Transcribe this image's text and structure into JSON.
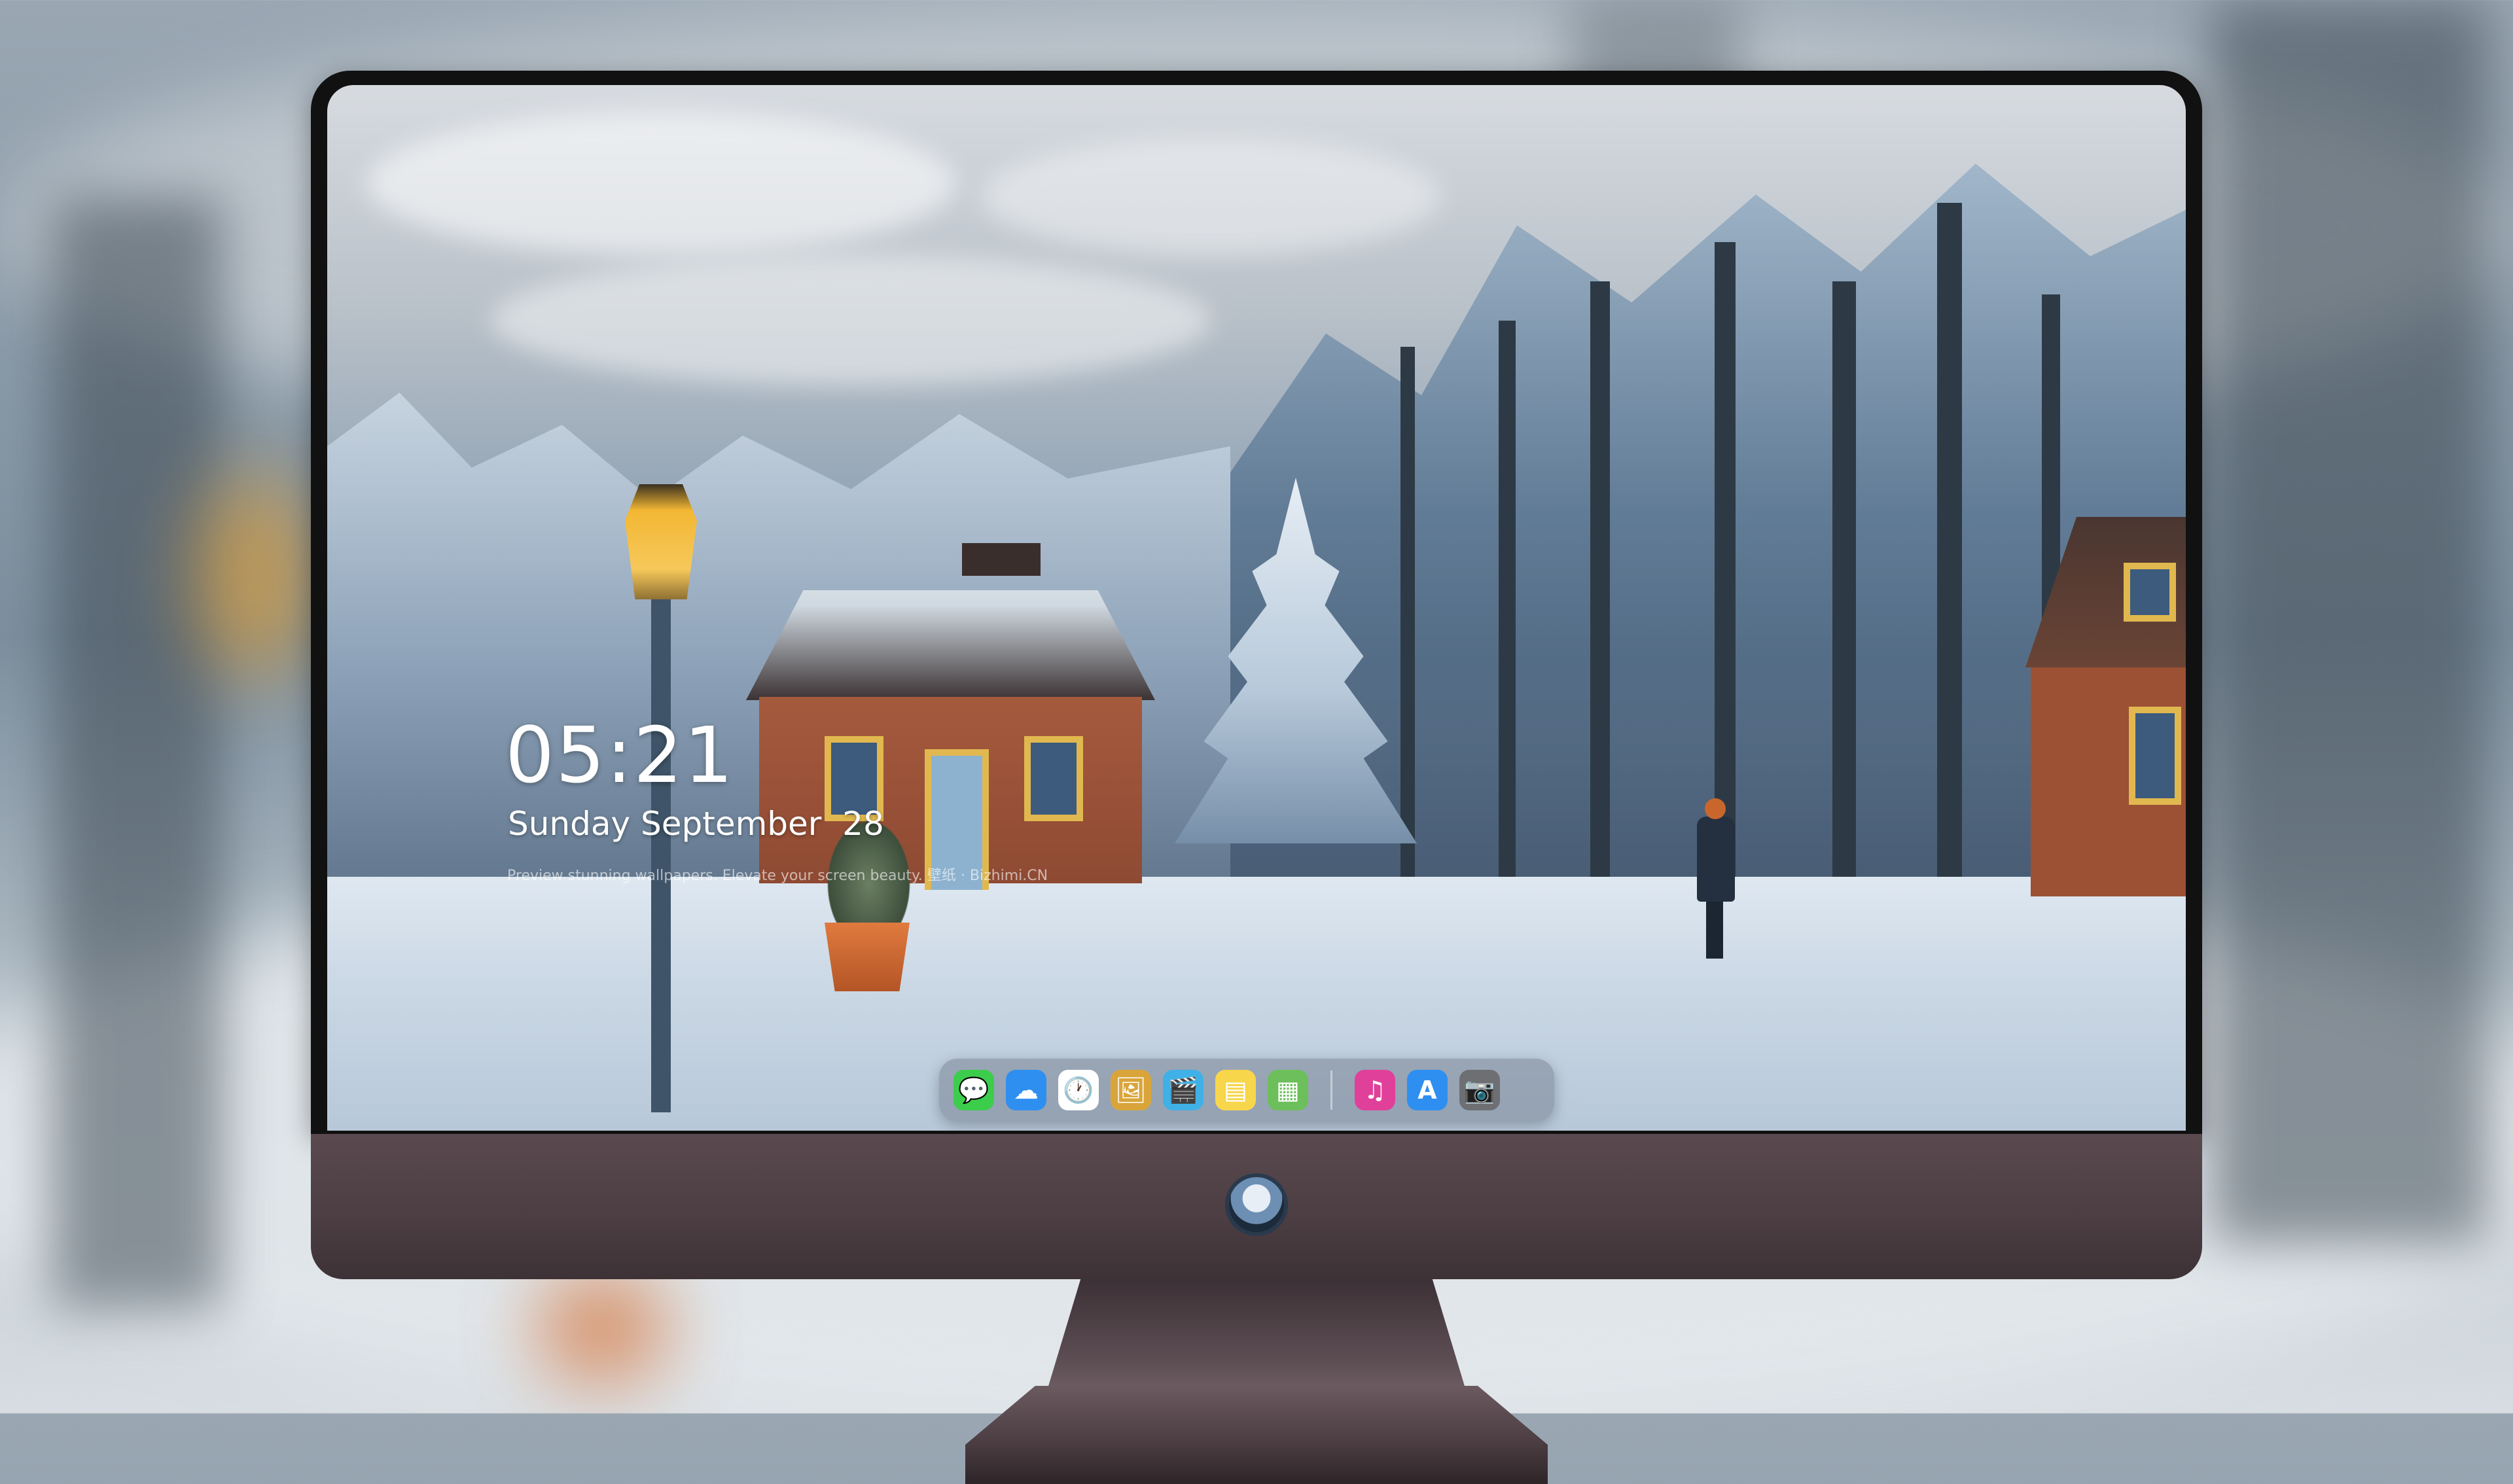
{
  "lockscreen": {
    "time": "05:21",
    "date": "Sunday September  28",
    "tagline": "Preview stunning wallpapers. Elevate your screen beauty. 壁纸 · Bizhimi.CN"
  },
  "dock": {
    "apps": [
      {
        "name": "messages",
        "glyph": "💬",
        "color": "#3ccd4d"
      },
      {
        "name": "weather",
        "glyph": "☁",
        "color": "#2f8ff0"
      },
      {
        "name": "clock",
        "glyph": "🕐",
        "color": "#ffffff"
      },
      {
        "name": "preview",
        "glyph": "🖼",
        "color": "#d9a53a"
      },
      {
        "name": "clips",
        "glyph": "🎬",
        "color": "#3fb1e6"
      },
      {
        "name": "notes",
        "glyph": "▤",
        "color": "#f8d64b"
      },
      {
        "name": "photos",
        "glyph": "▦",
        "color": "#6cbf5a"
      },
      {
        "name": "music",
        "glyph": "♫",
        "color": "#e0409a"
      },
      {
        "name": "app-store",
        "glyph": "A",
        "color": "#2f8ff0"
      },
      {
        "name": "camera",
        "glyph": "📷",
        "color": "#6d6f73"
      }
    ]
  }
}
